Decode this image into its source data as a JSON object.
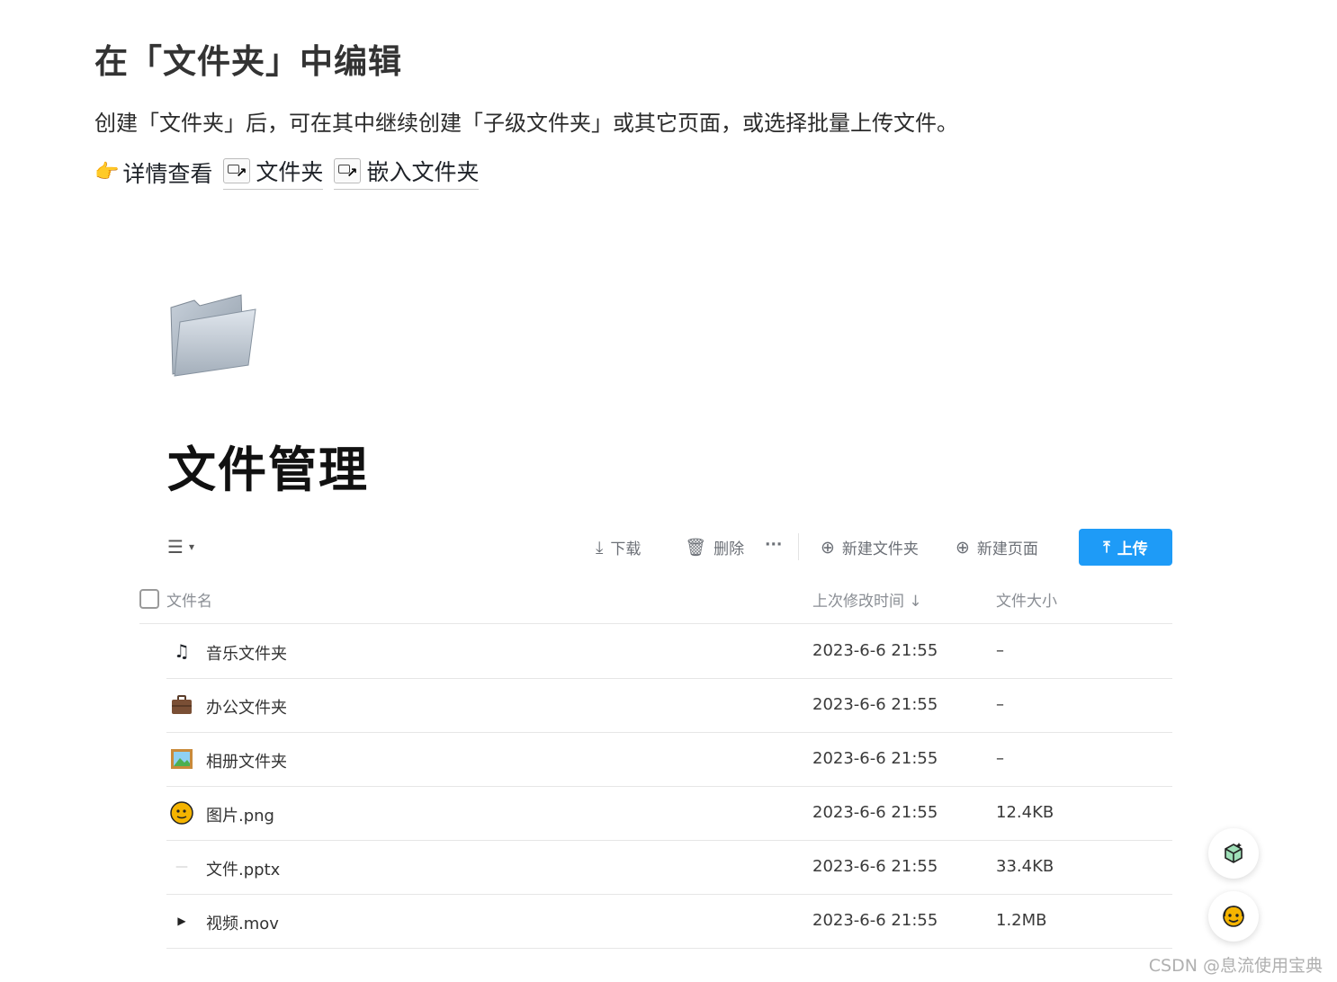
{
  "heading": "在「文件夹」中编辑",
  "description": "创建「文件夹」后，可在其中继续创建「子级文件夹」或其它页面，或选择批量上传文件。",
  "links_line": {
    "prefix": "详情查看",
    "links": [
      "文件夹",
      "嵌入文件夹"
    ]
  },
  "page": {
    "title": "文件管理"
  },
  "toolbar": {
    "download": "下载",
    "delete": "删除",
    "more": "···",
    "new_folder": "新建文件夹",
    "new_page": "新建页面",
    "upload": "上传"
  },
  "table": {
    "headers": {
      "name": "文件名",
      "modified": "上次修改时间 ↓",
      "size": "文件大小"
    },
    "rows": [
      {
        "icon": "music-note-icon",
        "name": "音乐文件夹",
        "modified": "2023-6-6 21:55",
        "size": "–"
      },
      {
        "icon": "briefcase-icon",
        "name": "办公文件夹",
        "modified": "2023-6-6 21:55",
        "size": "–"
      },
      {
        "icon": "framed-picture-icon",
        "name": "相册文件夹",
        "modified": "2023-6-6 21:55",
        "size": "–"
      },
      {
        "icon": "image-thumbnail-icon",
        "name": "图片.png",
        "modified": "2023-6-6 21:55",
        "size": "12.4KB"
      },
      {
        "icon": "pptx-file-icon",
        "name": "文件.pptx",
        "modified": "2023-6-6 21:55",
        "size": "33.4KB"
      },
      {
        "icon": "video-file-icon",
        "name": "视频.mov",
        "modified": "2023-6-6 21:55",
        "size": "1.2MB"
      }
    ]
  },
  "watermark": "CSDN @息流使用宝典",
  "colors": {
    "accent": "#1e9bf7",
    "divider": "#e6e6e6",
    "muted_text": "#8a8e94"
  }
}
